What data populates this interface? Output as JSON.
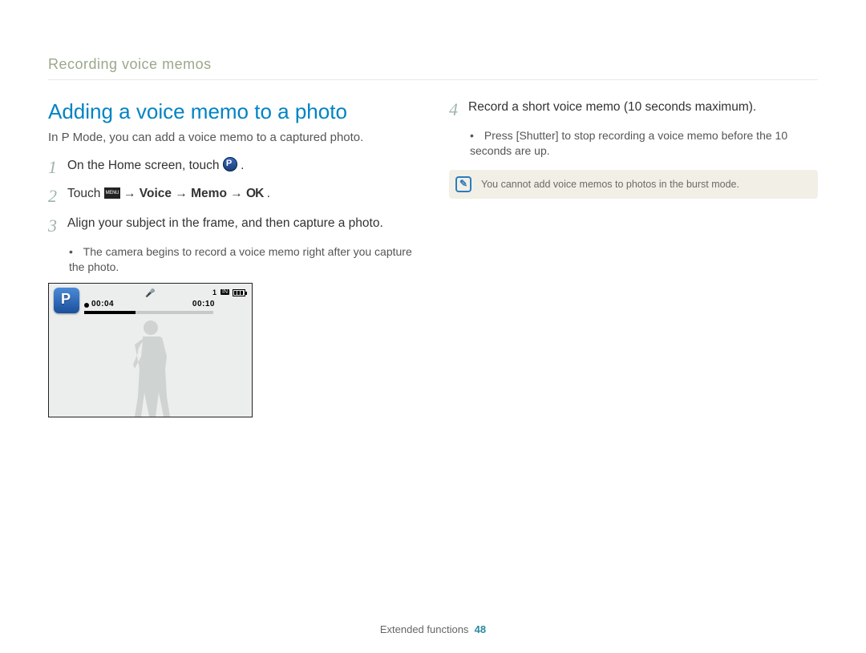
{
  "breadcrumb": "Recording voice memos",
  "heading": "Adding a voice memo to a photo",
  "intro": "In P Mode, you can add a voice memo to a captured photo.",
  "steps": {
    "s1_pre": "On the Home screen, touch ",
    "s1_post": ".",
    "s2_pre": "Touch ",
    "s2_arrow1": " → ",
    "s2_voice": "Voice",
    "s2_arrow2": " → ",
    "s2_memo": "Memo",
    "s2_arrow3": " → ",
    "s2_ok": "OK",
    "s2_post": ".",
    "s3": "Align your subject in the frame, and then capture a photo.",
    "s3_bullet": "The camera begins to record a voice memo right after you capture the photo.",
    "s4": "Record a short voice memo (10 seconds maximum).",
    "s4_bullet_pre": "Press [",
    "s4_bullet_btn": "Shutter",
    "s4_bullet_post": "] to stop recording a voice memo before the 10 seconds are up."
  },
  "screen": {
    "elapsed": "00:04",
    "total": "00:10",
    "count": "1",
    "in": "IN"
  },
  "note": "You cannot add voice memos to photos in the burst mode.",
  "footer_section": "Extended functions",
  "footer_page": "48"
}
